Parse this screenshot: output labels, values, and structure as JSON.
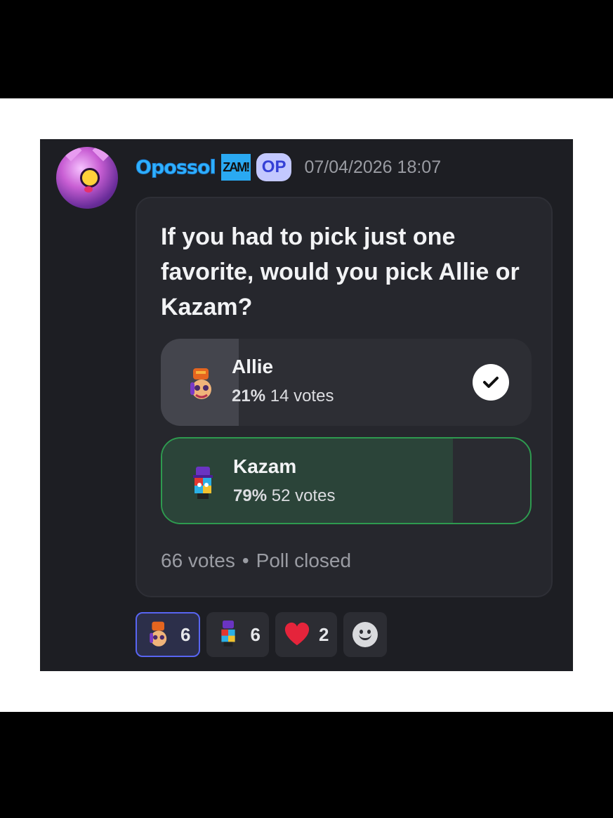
{
  "message": {
    "username": "Opossol",
    "tag_zam": "ZAM!",
    "tag_op": "OP",
    "timestamp": "07/04/2026 18:07"
  },
  "poll": {
    "question": "If you had to pick just one favorite, would you pick Allie or Kazam?",
    "options": [
      {
        "label": "Allie",
        "percent": "21%",
        "votes": "14 votes",
        "fraction": 0.21,
        "selected": true
      },
      {
        "label": "Kazam",
        "percent": "79%",
        "votes": "52 votes",
        "fraction": 0.79,
        "winner": true
      }
    ],
    "footer": {
      "total": "66 votes",
      "status": "Poll closed"
    }
  },
  "reactions": [
    {
      "icon": "allie-emoji-icon",
      "count": "6",
      "active": true
    },
    {
      "icon": "kazam-emoji-icon",
      "count": "6",
      "active": false
    },
    {
      "icon": "heart-icon",
      "count": "2",
      "active": false
    }
  ],
  "colors": {
    "accent": "#5865f2",
    "username": "#2fb1ff",
    "winner_border": "#2e9a4f"
  }
}
